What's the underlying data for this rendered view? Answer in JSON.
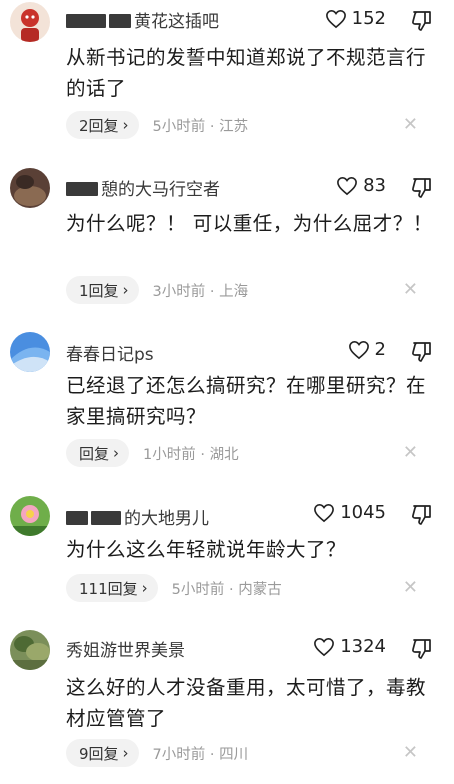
{
  "comments": [
    {
      "username": "黄花这插吧",
      "likes": "152",
      "text": "从新书记的发誓中知道郑说了不规范言行的话了",
      "replies": "2回复",
      "time": "5小时前",
      "location": "江苏"
    },
    {
      "username": "憩的大马行空者",
      "likes": "83",
      "text": "为什么呢？！ 可以重任，为什么屈才？！",
      "replies": "1回复",
      "time": "3小时前",
      "location": "上海"
    },
    {
      "username": "春春日记ps",
      "likes": "2",
      "text": "已经退了还怎么搞研究？在哪里研究？在家里搞研究吗？",
      "replies": "回复",
      "time": "1小时前",
      "location": "湖北"
    },
    {
      "username": "的大地男儿",
      "likes": "1045",
      "text": "为什么这么年轻就说年龄大了？",
      "replies": "111回复",
      "time": "5小时前",
      "location": "内蒙古"
    },
    {
      "username": "秀姐游世界美景",
      "likes": "1324",
      "text": "这么好的人才没备重用，太可惜了，毒教材应管管了",
      "replies": "9回复",
      "time": "7小时前",
      "location": "四川"
    }
  ],
  "meta_separator": " · ",
  "close_glyph": "✕",
  "reply_chevron": "›",
  "icons": {
    "like": "heart-outline-icon",
    "dislike": "thumbs-down-icon",
    "close": "close-icon"
  },
  "colors": {
    "meta": "#9a9a9a",
    "pill_bg": "#f2f2f2",
    "close": "#c6c6c6"
  }
}
